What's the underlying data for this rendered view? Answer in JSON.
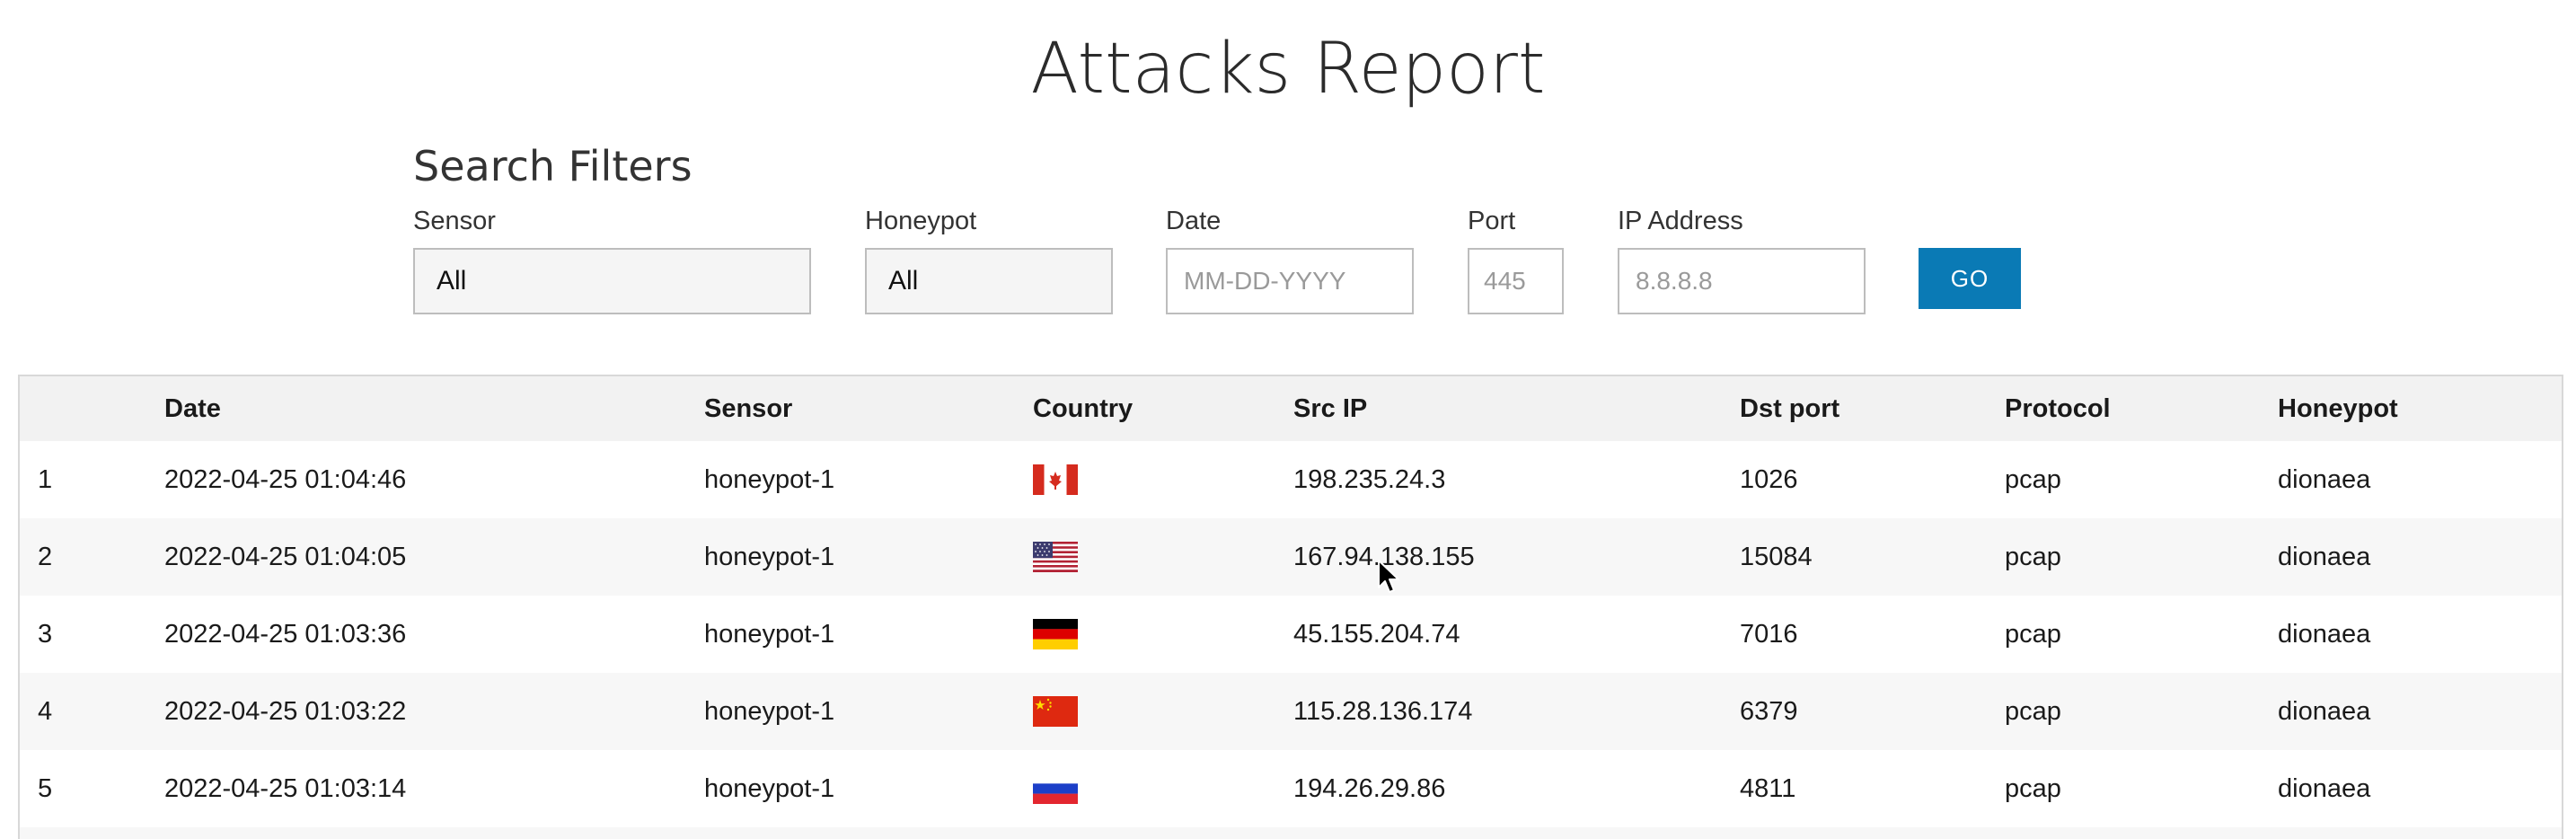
{
  "page": {
    "title": "Attacks Report"
  },
  "filters": {
    "heading": "Search Filters",
    "sensor": {
      "label": "Sensor",
      "value": "All"
    },
    "honeypot": {
      "label": "Honeypot",
      "value": "All"
    },
    "date": {
      "label": "Date",
      "placeholder": "MM-DD-YYYY"
    },
    "port": {
      "label": "Port",
      "placeholder": "445"
    },
    "ip": {
      "label": "IP Address",
      "placeholder": "8.8.8.8"
    },
    "go_label": "GO",
    "go_color": "#0a7ab5"
  },
  "table": {
    "headers": [
      "",
      "Date",
      "Sensor",
      "Country",
      "Src IP",
      "Dst port",
      "Protocol",
      "Honeypot"
    ],
    "rows": [
      {
        "num": "1",
        "date": "2022-04-25 01:04:46",
        "sensor": "honeypot-1",
        "country_flag": "canada-flag-icon",
        "src_ip": "198.235.24.3",
        "dst_port": "1026",
        "protocol": "pcap",
        "honeypot": "dionaea"
      },
      {
        "num": "2",
        "date": "2022-04-25 01:04:05",
        "sensor": "honeypot-1",
        "country_flag": "usa-flag-icon",
        "src_ip": "167.94.138.155",
        "dst_port": "15084",
        "protocol": "pcap",
        "honeypot": "dionaea"
      },
      {
        "num": "3",
        "date": "2022-04-25 01:03:36",
        "sensor": "honeypot-1",
        "country_flag": "germany-flag-icon",
        "src_ip": "45.155.204.74",
        "dst_port": "7016",
        "protocol": "pcap",
        "honeypot": "dionaea"
      },
      {
        "num": "4",
        "date": "2022-04-25 01:03:22",
        "sensor": "honeypot-1",
        "country_flag": "china-flag-icon",
        "src_ip": "115.28.136.174",
        "dst_port": "6379",
        "protocol": "pcap",
        "honeypot": "dionaea"
      },
      {
        "num": "5",
        "date": "2022-04-25 01:03:14",
        "sensor": "honeypot-1",
        "country_flag": "russia-flag-icon",
        "src_ip": "194.26.29.86",
        "dst_port": "4811",
        "protocol": "pcap",
        "honeypot": "dionaea"
      }
    ]
  }
}
